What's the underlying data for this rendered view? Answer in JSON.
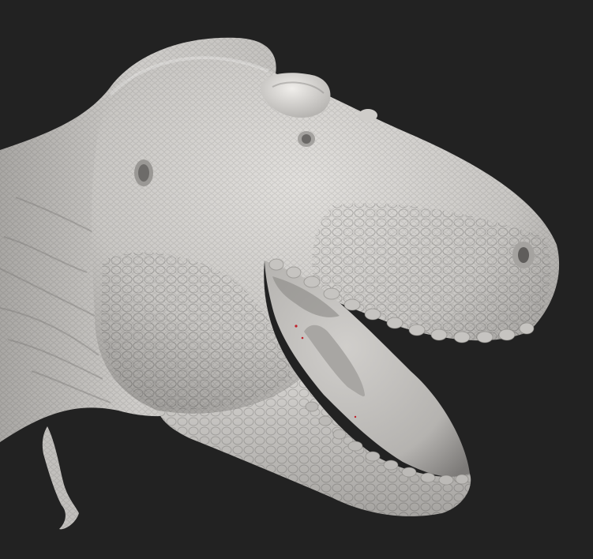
{
  "scene": {
    "subject": "dinosaur-head-sculpt",
    "colors": {
      "background": "#222222",
      "skin_base": "#c8c6c3",
      "skin_shadow": "#8f8d8a",
      "skin_highlight": "#e4e2df",
      "mouth_interior": "#b9b7b4",
      "mouth_dark": "#6f6d6b",
      "red_speckle": "#c0202a"
    }
  }
}
